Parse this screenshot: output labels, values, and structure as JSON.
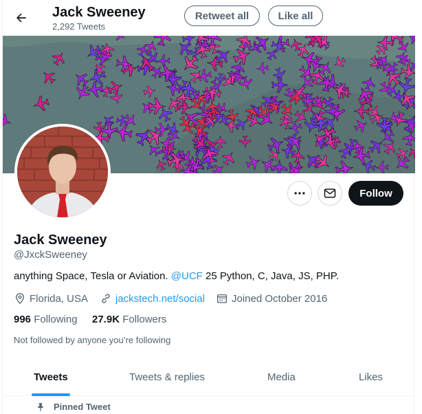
{
  "header": {
    "name": "Jack Sweeney",
    "tweet_count": "2,292 Tweets",
    "retweet_all": "Retweet all",
    "like_all": "Like all"
  },
  "profile": {
    "name": "Jack Sweeney",
    "handle": "@JxckSweeney",
    "bio_before": "anything Space, Tesla or Aviation. ",
    "bio_mention": "@UCF",
    "bio_after": " 25 Python, C, Java, JS, PHP.",
    "location": "Florida, USA",
    "website": "jackstech.net/social",
    "joined": "Joined October 2016",
    "following_count": "996",
    "following_label": "Following",
    "followers_count": "27.9K",
    "followers_label": "Followers",
    "not_followed": "Not followed by anyone you’re following",
    "follow_button": "Follow"
  },
  "tabs": [
    {
      "label": "Tweets",
      "active": true
    },
    {
      "label": "Tweets & replies"
    },
    {
      "label": "Media"
    },
    {
      "label": "Likes"
    }
  ],
  "pinned_label": "Pinned Tweet",
  "icons": {
    "back": "arrow-left-icon",
    "more": "more-dots-icon",
    "message": "mail-icon",
    "location": "location-pin-icon",
    "link": "link-icon",
    "calendar": "calendar-icon",
    "pin": "pin-icon"
  },
  "colors": {
    "accent": "#1d9bf0",
    "text": "#0f1419",
    "secondary": "#536471",
    "follow_bg": "#0f1419"
  }
}
